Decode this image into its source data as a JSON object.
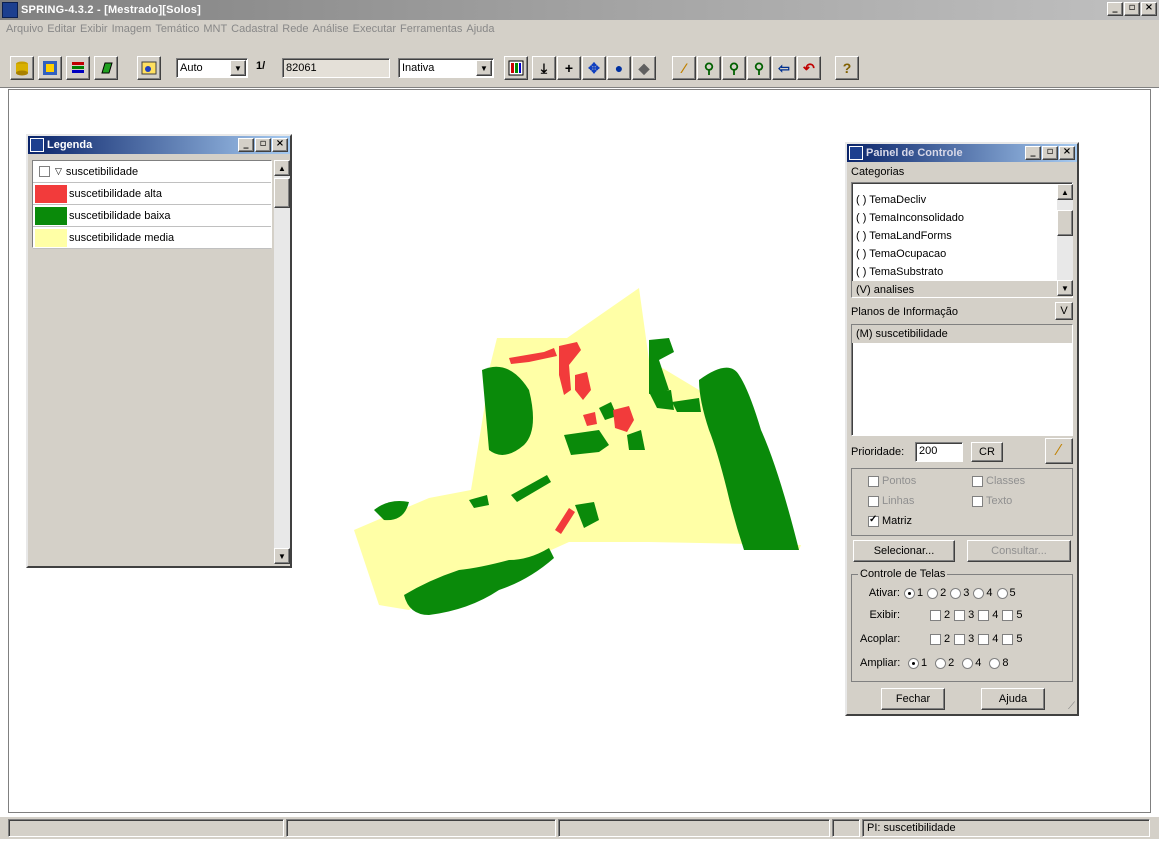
{
  "window": {
    "title": "SPRING-4.3.2 - [Mestrado][Solos]",
    "min": "_",
    "max": "▫",
    "close": "×"
  },
  "menu": [
    "Arquivo",
    "Editar",
    "Exibir",
    "Imagem",
    "Temático",
    "MNT",
    "Cadastral",
    "Rede",
    "Análise",
    "Executar",
    "Ferramentas",
    "Ajuda"
  ],
  "toolbar": {
    "zoom_mode": "Auto",
    "scale_prefix": "1/",
    "scale_value": "82061",
    "cursor_mode": "Inativa",
    "help": "?"
  },
  "legend": {
    "title": "Legenda",
    "layer": "suscetibilidade",
    "items": [
      {
        "label": "suscetibilidade alta",
        "color": "#f23b3b"
      },
      {
        "label": "suscetibilidade baixa",
        "color": "#0a8a0a"
      },
      {
        "label": "suscetibilidade media",
        "color": "#ffffa6"
      }
    ]
  },
  "panel": {
    "title": "Painel de Controle",
    "categorias_label": "Categorias",
    "categorias": [
      "( ) TemaDecliv",
      "( ) TemaInconsolidado",
      "( ) TemaLandForms",
      "( ) TemaOcupacao",
      "( ) TemaSubstrato",
      "(V) analises"
    ],
    "planos_label": "Planos de Informação",
    "planos_btn": "V",
    "planos": [
      "(M) suscetibilidade"
    ],
    "prioridade_label": "Prioridade:",
    "prioridade_value": "200",
    "cr_label": "CR",
    "pontos": "Pontos",
    "classes": "Classes",
    "linhas": "Linhas",
    "texto": "Texto",
    "matriz": "Matriz",
    "selecionar": "Selecionar...",
    "consultar": "Consultar...",
    "telas_label": "Controle de Telas",
    "ativar": "Ativar:",
    "exibir": "Exibir:",
    "acoplar": "Acoplar:",
    "ampliar": "Ampliar:",
    "n1": "1",
    "n2": "2",
    "n3": "3",
    "n4": "4",
    "n5": "5",
    "n8": "8",
    "fechar": "Fechar",
    "ajuda": "Ajuda"
  },
  "status": {
    "pi": "PI: suscetibilidade"
  },
  "colors": {
    "alta": "#f23b3b",
    "baixa": "#0a8a0a",
    "media": "#ffffa6"
  }
}
